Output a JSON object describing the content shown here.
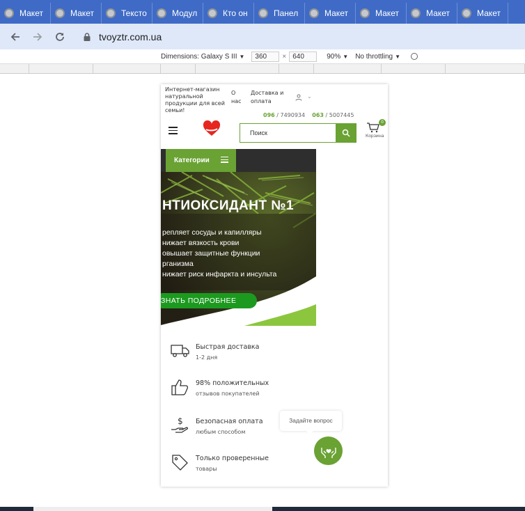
{
  "browser": {
    "tabs": [
      "Макет",
      "Макет",
      "Тексто",
      "Модул",
      "Кто он",
      "Панел",
      "Макет",
      "Макет",
      "Макет",
      "Макет"
    ],
    "url": "tvoyztr.com.ua"
  },
  "devtools": {
    "dimensions": "Dimensions: Galaxy S III",
    "width": "360",
    "height": "640",
    "times": "×",
    "zoom": "90%",
    "throttle": "No throttling"
  },
  "site": {
    "tagline": "Интернет-магазин натуральной продукции для всей семьи!",
    "about": "О нас",
    "delivery": "Доставка и оплата",
    "phone1_code": "096",
    "phone1_num": " / 7490934",
    "phone2_code": "063",
    "phone2_num": " / 5007445",
    "search_placeholder": "Поиск",
    "cart_count": "0",
    "cart_label": "Корзина",
    "categories": "Категории",
    "banner": {
      "title": "НТИОКСИДАНТ №1",
      "lines": [
        "репляет сосуды и капилляры",
        "нижает вязкость крови",
        "овышает защитные функции",
        "рганизма",
        "нижает риск инфаркта и инсульта"
      ],
      "button": "ЗНАТЬ ПОДРОБНЕЕ"
    },
    "features": [
      {
        "title": "Быстрая доставка",
        "sub": "1-2 дня"
      },
      {
        "title": "98% положительных",
        "sub": "отзывов покупателей"
      },
      {
        "title": "Безопасная оплата",
        "sub": "любым способом"
      },
      {
        "title": "Только проверенные",
        "sub": "товары"
      }
    ],
    "ask": "Задайте вопрос"
  },
  "colors": {
    "accent": "#6aa234",
    "tabbar": "#3f6bc6",
    "banner_button": "#1c9a1f"
  }
}
